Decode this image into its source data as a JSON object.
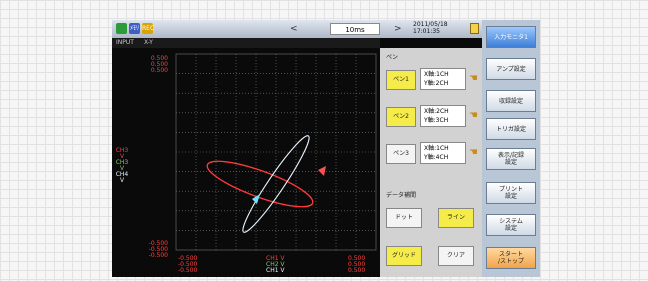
{
  "topbar": {
    "icons": [
      {
        "name": "green-run-icon",
        "color": "#2e9b3a",
        "text": ""
      },
      {
        "name": "blue-mode-icon",
        "color": "#3b5fc4",
        "text": "ﾒﾓﾘ"
      },
      {
        "name": "yellow-status-icon",
        "color": "#d9a400",
        "text": "REC"
      }
    ],
    "prev_arrow": "<",
    "time_div": "10ms",
    "next_arrow": ">",
    "date": "2011/05/18",
    "time": "17:01:35"
  },
  "subbar": {
    "input": "INPUT",
    "mode": "X-Y"
  },
  "plot": {
    "y_top": [
      "0.500",
      "0.500",
      "0.500"
    ],
    "y_mid": [
      "CH3",
      "V",
      "CH3",
      "V",
      "CH4",
      "V"
    ],
    "y_bot": [
      "-0.500",
      "-0.500",
      "-0.500"
    ],
    "x_left": [
      "-0.500",
      "-0.500",
      "-0.500"
    ],
    "x_mid": [
      "CH1 V",
      "CH2 V",
      "CH1 V"
    ],
    "x_right": [
      "0.500",
      "0.500",
      "0.500"
    ]
  },
  "panel": {
    "pen_title": "ペン",
    "pens": [
      {
        "label": "ペン1",
        "active": true,
        "x": "X軸:1CH",
        "y": "Y軸:2CH"
      },
      {
        "label": "ペン2",
        "active": true,
        "x": "X軸:2CH",
        "y": "Y軸:3CH"
      },
      {
        "label": "ペン3",
        "active": false,
        "x": "X軸:1CH",
        "y": "Y軸:4CH"
      }
    ],
    "data_title": "データ補間",
    "dot": "ドット",
    "line": "ライン",
    "grid": "グリッド",
    "clear": "クリア"
  },
  "side": {
    "buttons": [
      [
        "入力モニタ1"
      ],
      [
        "アンプ設定"
      ],
      [
        "収録設定"
      ],
      [
        "トリガ設定"
      ],
      [
        "表示/記録",
        "設定"
      ],
      [
        "プリント",
        "設定"
      ],
      [
        "システム",
        "設定"
      ],
      [
        "スタート",
        "/ストップ"
      ]
    ]
  },
  "colors": {
    "pen1": "#ff3b3b",
    "pen2": "#e8f4ff",
    "grid": "#7a7a7a",
    "red_axis": "#ff4040",
    "green_axis": "#7bd36b"
  }
}
